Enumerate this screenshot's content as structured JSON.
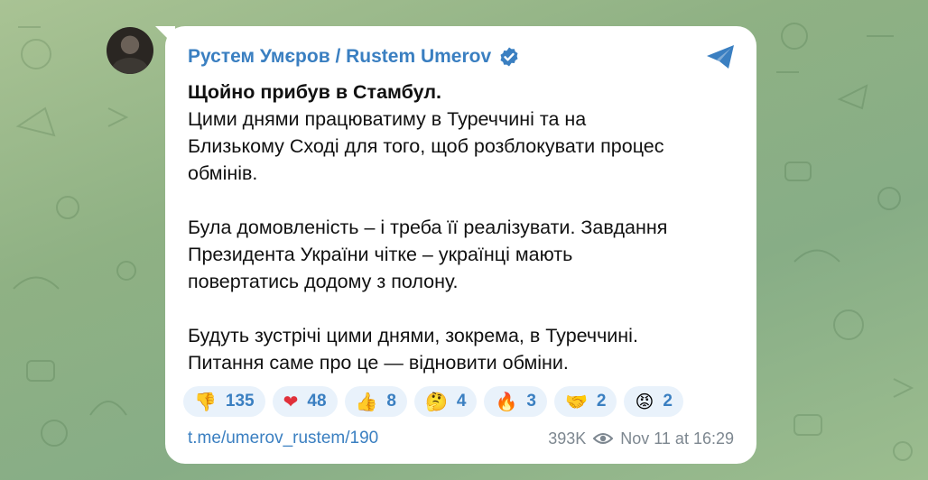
{
  "post": {
    "author": "Рустем Умєров / Rustem Umerov",
    "verified_icon": "verified-badge-icon",
    "share_icon": "telegram-send-icon",
    "paragraphs": [
      {
        "lines": [
          "Щойно прибув в Стамбул."
        ],
        "bold_first_line": true,
        "extra_lines": [
          "Цими днями працюватиму в Туреччині та на",
          "Близькому Сході для того, щоб розблокувати процес",
          "обмінів."
        ]
      },
      {
        "lines": [
          "Була домовленість – і треба її реалізувати. Завдання",
          "Президента України чітке – українці мають",
          "повертатись додому з полону."
        ]
      },
      {
        "lines": [
          "Будуть зустрічі цими днями, зокрема, в Туреччині.",
          "Питання саме про це — відновити обміни."
        ]
      }
    ],
    "reactions": [
      {
        "icon": "thumbs-down-icon",
        "emoji": "👎",
        "count": "135"
      },
      {
        "icon": "red-heart-icon",
        "emoji": "❤",
        "count": "48"
      },
      {
        "icon": "thumbs-up-icon",
        "emoji": "👍",
        "count": "8"
      },
      {
        "icon": "thinking-face-icon",
        "emoji": "🤔",
        "count": "4"
      },
      {
        "icon": "fire-icon",
        "emoji": "🔥",
        "count": "3"
      },
      {
        "icon": "handshake-icon",
        "emoji": "🤝",
        "count": "2"
      },
      {
        "icon": "angry-face-icon",
        "emoji": "😡",
        "count": "2"
      }
    ],
    "link": "t.me/umerov_rustem/190",
    "views": "393K",
    "timestamp": "Nov 11 at 16:29"
  },
  "colors": {
    "accent": "#3a7fc1",
    "reaction_bg": "#e9f2fb",
    "meta": "#7d8790"
  }
}
